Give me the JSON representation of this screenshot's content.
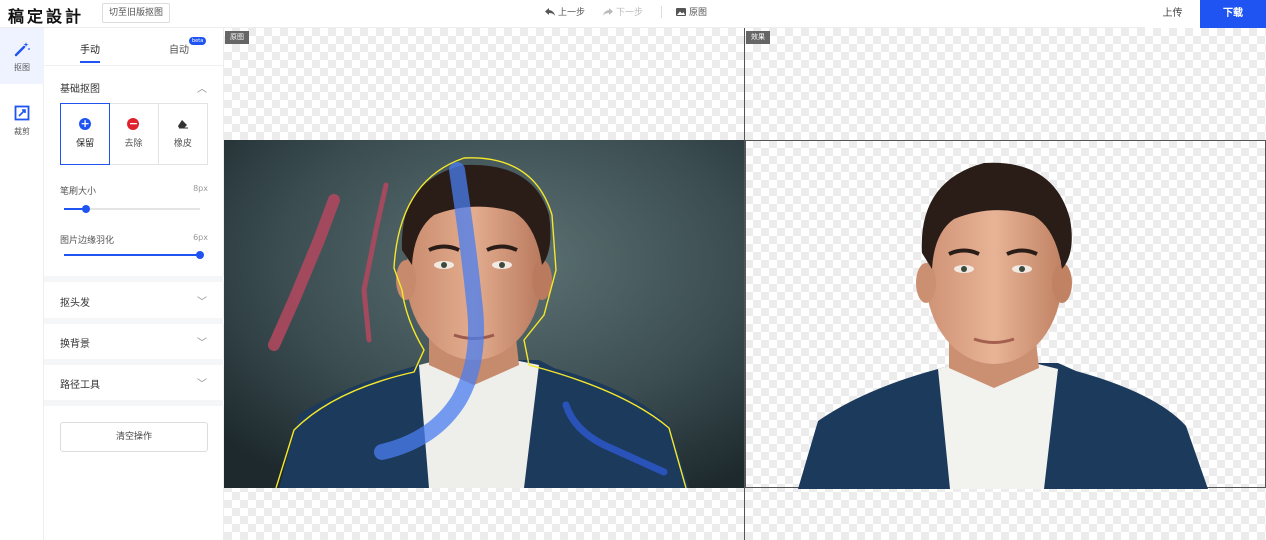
{
  "app": {
    "logo": "稿定設計",
    "old_version_button": "切至旧版抠图"
  },
  "toolbar": {
    "undo": "上一步",
    "redo": "下一步",
    "original": "原图"
  },
  "header_actions": {
    "upload": "上传",
    "download": "下载"
  },
  "rail": {
    "cutout": "抠图",
    "crop": "裁剪"
  },
  "panel": {
    "tabs": {
      "manual": "手动",
      "auto": "自动",
      "auto_badge": "beta"
    },
    "basic_section": "基础抠图",
    "modes": {
      "keep": "保留",
      "remove": "去除",
      "eraser": "橡皮"
    },
    "brush_size": {
      "label": "笔刷大小",
      "value": "8px",
      "fraction": 0.16
    },
    "feather": {
      "label": "图片边缘羽化",
      "value": "6px",
      "fraction": 1.0
    },
    "hair_section": "抠头发",
    "background_section": "换背景",
    "path_section": "路径工具",
    "clear_button": "清空操作"
  },
  "canvas": {
    "original_tag": "原图",
    "effect_tag": "效果"
  },
  "colors": {
    "accent": "#1f54f2",
    "keep_dot": "#1f54f2",
    "remove_dot": "#e0202e",
    "outline": "#f5e72a",
    "keep_stroke": "#4a7ef0",
    "remove_stroke": "#b5485f"
  }
}
